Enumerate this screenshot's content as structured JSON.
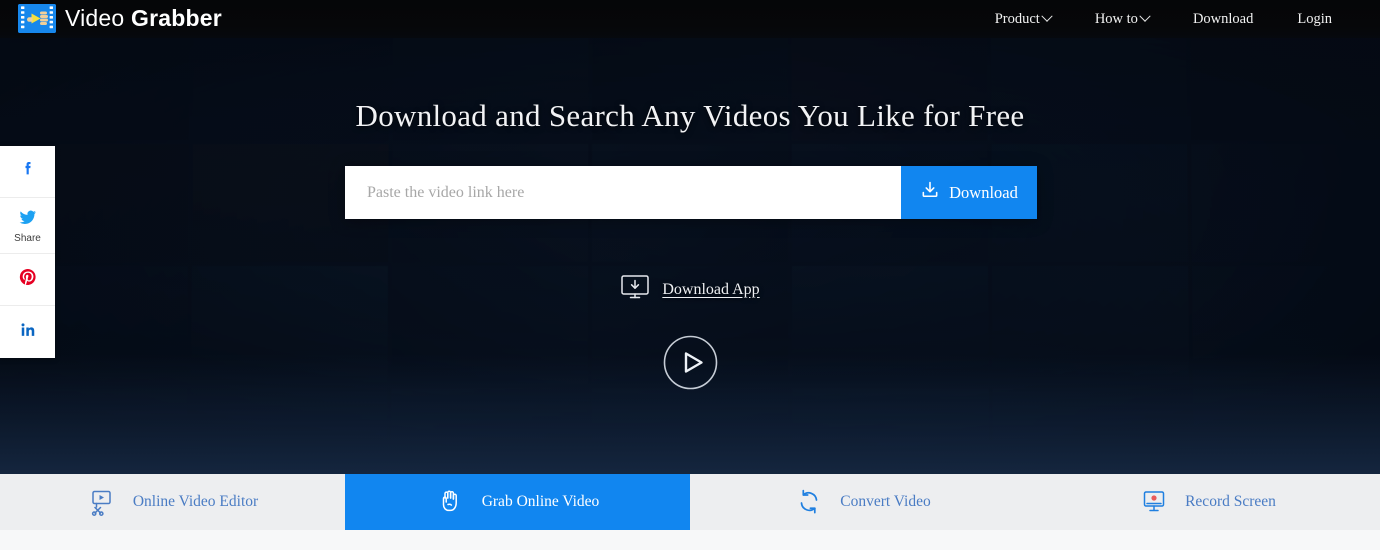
{
  "header": {
    "logo_text_light": "Video ",
    "logo_text_bold": "Grabber",
    "logo_icon": "film-strip-grab-icon",
    "nav": [
      {
        "label": "Product",
        "icon": "chevron-down-icon",
        "has_caret": true
      },
      {
        "label": "How to",
        "icon": "chevron-down-icon",
        "has_caret": true
      },
      {
        "label": "Download",
        "has_caret": false
      },
      {
        "label": "Login",
        "has_caret": false
      }
    ]
  },
  "hero": {
    "headline": "Download and Search Any Videos You Like for Free",
    "search": {
      "placeholder": "Paste the video link here",
      "value": "",
      "button_label": "Download",
      "button_icon": "download-tray-icon",
      "button_color": "#1186f0"
    },
    "download_app": {
      "label": "Download App",
      "icon": "desktop-download-icon"
    },
    "play_button": {
      "icon": "play-circle-icon"
    }
  },
  "social_sidebar": [
    {
      "name": "facebook",
      "icon": "facebook-icon",
      "glyph": "f",
      "color": "#1877f2",
      "label": ""
    },
    {
      "name": "twitter",
      "icon": "twitter-bird-icon",
      "color": "#1da1f2",
      "label": "Share"
    },
    {
      "name": "pinterest",
      "icon": "pinterest-icon",
      "glyph": "P",
      "color": "#e60023",
      "label": ""
    },
    {
      "name": "linkedin",
      "icon": "linkedin-icon",
      "glyph": "in",
      "color": "#0a66c2",
      "label": ""
    }
  ],
  "tabs": [
    {
      "label": "Online Video Editor",
      "icon": "video-editor-scissors-icon",
      "active": false
    },
    {
      "label": "Grab Online Video",
      "icon": "grab-hand-icon",
      "active": true
    },
    {
      "label": "Convert Video",
      "icon": "convert-arrows-icon",
      "active": false
    },
    {
      "label": "Record Screen",
      "icon": "record-screen-icon",
      "active": false
    }
  ],
  "theme": {
    "accent": "#1186f0",
    "tab_bar_bg": "#edeef0",
    "tab_text": "#4a7cc4",
    "header_bg": "#060709"
  },
  "background_tiles": [
    {
      "a": "#2b2f38",
      "b": "#0d1118"
    },
    {
      "a": "#1c2a38",
      "b": "#0a1018"
    },
    {
      "a": "#23313f",
      "b": "#0c1220"
    },
    {
      "a": "#1a2634",
      "b": "#080d16"
    },
    {
      "a": "#3a2430",
      "b": "#140c14"
    },
    {
      "a": "#24384e",
      "b": "#0d1824"
    },
    {
      "a": "#4a2230",
      "b": "#180a12"
    },
    {
      "a": "#4a3828",
      "b": "#140f0c"
    },
    {
      "a": "#4d3a22",
      "b": "#17110a"
    },
    {
      "a": "#2c3c4e",
      "b": "#0e1420"
    },
    {
      "a": "#223448",
      "b": "#0b121c"
    },
    {
      "a": "#1e3550",
      "b": "#0a1222"
    },
    {
      "a": "#1c4a6a",
      "b": "#08202e"
    },
    {
      "a": "#2a3550",
      "b": "#0c1022"
    },
    {
      "a": "#22465e",
      "b": "#0a1822"
    },
    {
      "a": "#2a5a70",
      "b": "#0c2028"
    },
    {
      "a": "#1c3448",
      "b": "#08121c"
    },
    {
      "a": "#1a2e42",
      "b": "#070f18"
    },
    {
      "a": "#214058",
      "b": "#09161f"
    },
    {
      "a": "#27506c",
      "b": "#0b1c28"
    },
    {
      "a": "#1e3a52",
      "b": "#08141e"
    },
    {
      "a": "#20384c",
      "b": "#0a121a"
    },
    {
      "a": "#1d3346",
      "b": "#091018"
    },
    {
      "a": "#223d52",
      "b": "#0a141d"
    },
    {
      "a": "#1b3044",
      "b": "#080e16"
    },
    {
      "a": "#214458",
      "b": "#091620"
    },
    {
      "a": "#1f3c50",
      "b": "#08131c"
    },
    {
      "a": "#1c3346",
      "b": "#070f17"
    }
  ]
}
